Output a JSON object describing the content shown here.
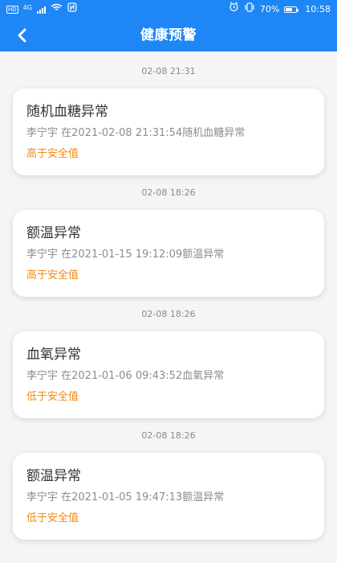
{
  "status_bar": {
    "hd": "HD",
    "network": "4G",
    "nfc": "N",
    "battery_percent": "70%",
    "battery_level": 0.7,
    "time": "10:58"
  },
  "header": {
    "title": "健康预警"
  },
  "alerts": [
    {
      "timestamp": "02-08 21:31",
      "title": "随机血糖异常",
      "detail": "李宁宇 在2021-02-08 21:31:54随机血糖异常",
      "level": "高于安全值"
    },
    {
      "timestamp": "02-08 18:26",
      "title": "额温异常",
      "detail": "李宁宇 在2021-01-15 19:12:09额温异常",
      "level": "高于安全值"
    },
    {
      "timestamp": "02-08 18:26",
      "title": "血氧异常",
      "detail": "李宁宇 在2021-01-06 09:43:52血氧异常",
      "level": "低于安全值"
    },
    {
      "timestamp": "02-08 18:26",
      "title": "额温异常",
      "detail": "李宁宇 在2021-01-05 19:47:13额温异常",
      "level": "低于安全值"
    }
  ],
  "colors": {
    "header": "#1f86f5",
    "warning": "#ef8b18",
    "background": "#f5f5f5"
  },
  "icons": {
    "back": "back-arrow-icon",
    "signal": "signal-icon",
    "wifi": "wifi-icon",
    "nfc": "nfc-icon",
    "alarm": "alarm-icon",
    "vibrate": "vibrate-icon",
    "battery": "battery-icon"
  }
}
